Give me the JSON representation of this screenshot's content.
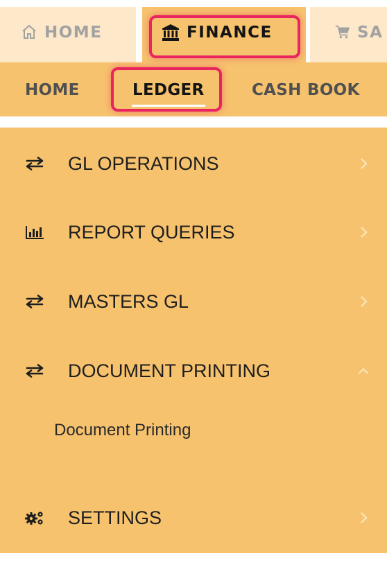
{
  "top_tabs": {
    "home": {
      "label": "HOME",
      "icon": "home-icon"
    },
    "finance": {
      "label": "FINANCE",
      "icon": "bank-icon"
    },
    "sales": {
      "label": "SA",
      "icon": "cart-icon"
    }
  },
  "sub_nav": {
    "home": "HOME",
    "ledger": "LEDGER",
    "cash_book": "CASH BOOK"
  },
  "menu": {
    "items": [
      {
        "label": "GL OPERATIONS",
        "icon": "transfer-arrows-icon",
        "expanded": false
      },
      {
        "label": "REPORT QUERIES",
        "icon": "bar-chart-icon",
        "expanded": false
      },
      {
        "label": "MASTERS GL",
        "icon": "transfer-arrows-icon",
        "expanded": false
      },
      {
        "label": "DOCUMENT PRINTING",
        "icon": "transfer-arrows-icon",
        "expanded": true
      },
      {
        "label": "SETTINGS",
        "icon": "cogs-icon",
        "expanded": false
      }
    ],
    "document_printing_children": [
      "Document Printing"
    ]
  },
  "colors": {
    "active_tab": "#f6c26e",
    "inactive_tab": "#fde8c9",
    "menu_bg": "#f6c26e",
    "highlight": "#e8255f"
  }
}
